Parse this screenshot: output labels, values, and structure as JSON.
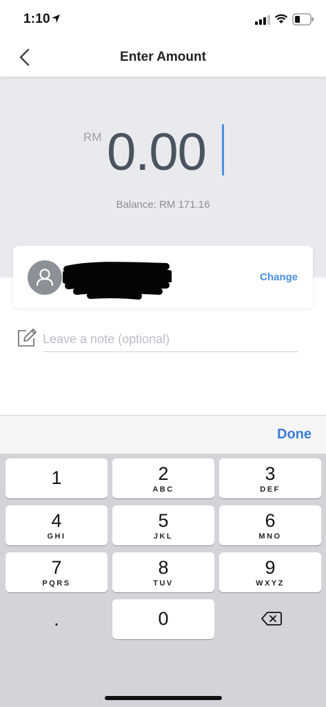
{
  "status_bar": {
    "time": "1:10",
    "icons": [
      "location-arrow-icon",
      "cellular-signal-icon",
      "wifi-icon",
      "battery-icon"
    ]
  },
  "header": {
    "title": "Enter Amount",
    "back_icon": "chevron-left-icon"
  },
  "amount": {
    "currency": "RM",
    "value": "0.00",
    "balance": "Balance: RM 171.16"
  },
  "recipient": {
    "avatar_icon": "person-icon",
    "name_redacted": true,
    "change_label": "Change"
  },
  "note": {
    "icon": "pencil-note-icon",
    "value": "",
    "placeholder": "Leave a note (optional)"
  },
  "keyboard": {
    "done_label": "Done",
    "keys": [
      {
        "num": "1",
        "letters": ""
      },
      {
        "num": "2",
        "letters": "ABC"
      },
      {
        "num": "3",
        "letters": "DEF"
      },
      {
        "num": "4",
        "letters": "GHI"
      },
      {
        "num": "5",
        "letters": "JKL"
      },
      {
        "num": "6",
        "letters": "MNO"
      },
      {
        "num": "7",
        "letters": "PQRS"
      },
      {
        "num": "8",
        "letters": "TUV"
      },
      {
        "num": "9",
        "letters": "WXYZ"
      },
      {
        "num": "0",
        "letters": ""
      }
    ],
    "decimal": ".",
    "backspace_icon": "backspace-icon"
  },
  "colors": {
    "accent": "#4a8fe0",
    "done": "#3b7dd8",
    "amount_bg": "#e8eaed",
    "keypad_bg": "#d2d4d9"
  }
}
